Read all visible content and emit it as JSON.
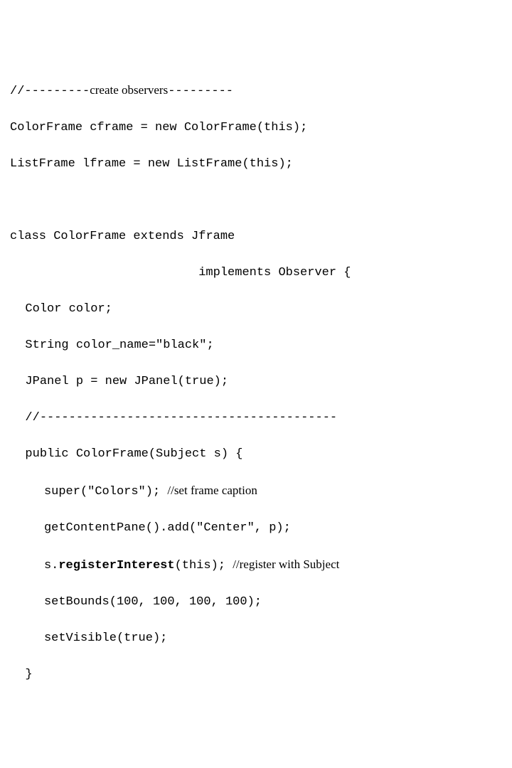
{
  "code": {
    "line1_pre": "//---------",
    "line1_serif": "create observers",
    "line1_post": "---------",
    "line2": "ColorFrame cframe = new ColorFrame(this);",
    "line3": "ListFrame lframe = new ListFrame(this);",
    "line5": "class ColorFrame extends Jframe",
    "line6": "implements Observer {",
    "line7": "Color color;",
    "line8": "String color_name=\"black\";",
    "line9": "JPanel p = new JPanel(true);",
    "line10": "//-----------------------------------------",
    "line11": "public ColorFrame(Subject s) {",
    "line12_pre": "super(\"Colors\"); ",
    "line12_serif": "//set frame caption",
    "line13": "getContentPane().add(\"Center\", p);",
    "line14_pre": "s.",
    "line14_bold": "registerInterest",
    "line14_mid": "(this); ",
    "line14_serif": "//register with Subject",
    "line15": "setBounds(100, 100, 100, 100);",
    "line16": "setVisible(true);",
    "line17": "}"
  }
}
